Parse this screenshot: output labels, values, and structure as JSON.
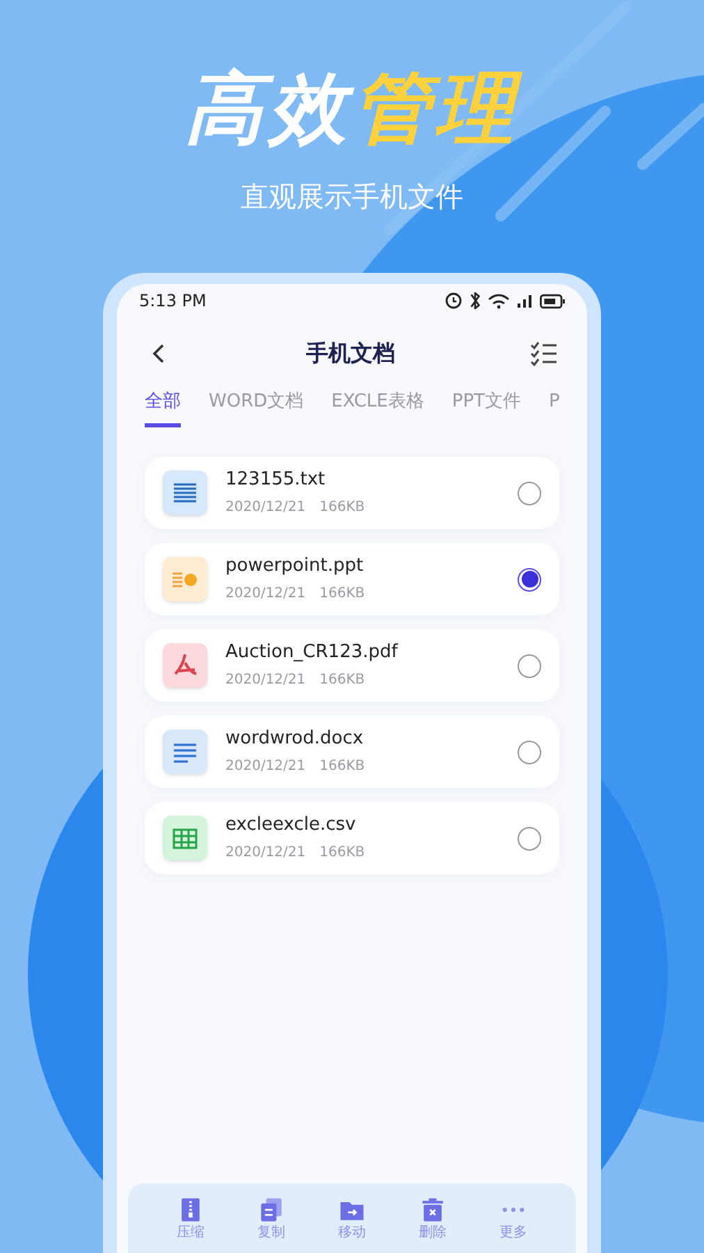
{
  "headline": {
    "plain": "高效",
    "accent": "管理"
  },
  "subtitle": "直观展示手机文件",
  "status_bar": {
    "time": "5:13 PM"
  },
  "header": {
    "title": "手机文档"
  },
  "tabs": [
    {
      "label": "全部",
      "selected": true
    },
    {
      "label": "WORD文档",
      "selected": false
    },
    {
      "label": "EXCLE表格",
      "selected": false
    },
    {
      "label": "PPT文件",
      "selected": false
    },
    {
      "label": "P",
      "selected": false
    }
  ],
  "files": [
    {
      "kind": "txt",
      "name": "123155.txt",
      "date": "2020/12/21",
      "size": "166KB",
      "selected": false
    },
    {
      "kind": "ppt",
      "name": "powerpoint.ppt",
      "date": "2020/12/21",
      "size": "166KB",
      "selected": true
    },
    {
      "kind": "pdf",
      "name": "Auction_CR123.pdf",
      "date": "2020/12/21",
      "size": "166KB",
      "selected": false
    },
    {
      "kind": "doc",
      "name": "wordwrod.docx",
      "date": "2020/12/21",
      "size": "166KB",
      "selected": false
    },
    {
      "kind": "sheet",
      "name": "excleexcle.csv",
      "date": "2020/12/21",
      "size": "166KB",
      "selected": false
    }
  ],
  "actions": [
    {
      "kind": "zip",
      "label": "压缩"
    },
    {
      "kind": "copy",
      "label": "复制"
    },
    {
      "kind": "move",
      "label": "移动"
    },
    {
      "kind": "delete",
      "label": "删除"
    },
    {
      "kind": "more",
      "label": "更多"
    }
  ]
}
